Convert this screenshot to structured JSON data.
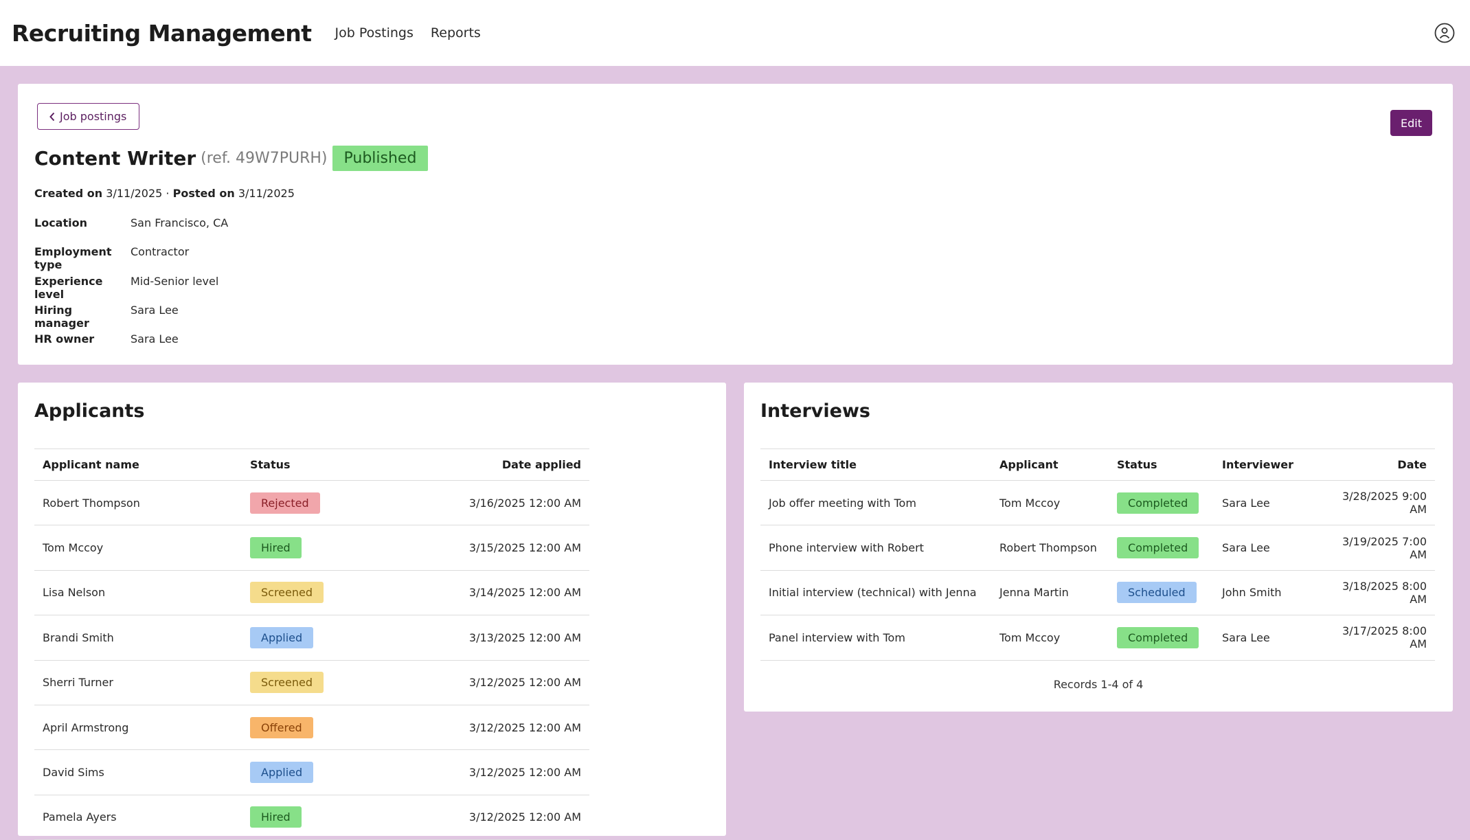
{
  "header": {
    "title": "Recruiting Management",
    "nav": [
      "Job Postings",
      "Reports"
    ]
  },
  "posting": {
    "back_label": "Job postings",
    "edit_label": "Edit",
    "title": "Content Writer",
    "ref": "(ref. 49W7PURH)",
    "status": "Published",
    "created_label": "Created on",
    "created_date": "3/11/2025",
    "separator": "·",
    "posted_label": "Posted on",
    "posted_date": "3/11/2025",
    "details": [
      {
        "label": "Location",
        "value": "San Francisco, CA"
      },
      {
        "label": "Employment type",
        "value": "Contractor"
      },
      {
        "label": "Experience level",
        "value": "Mid-Senior level"
      },
      {
        "label": "Hiring manager",
        "value": "Sara Lee"
      },
      {
        "label": "HR owner",
        "value": "Sara Lee"
      }
    ]
  },
  "status_colors": {
    "Rejected": {
      "bg": "#f1a6ab",
      "fg": "#8a1f27"
    },
    "Hired": {
      "bg": "#87e088",
      "fg": "#1c5a1f"
    },
    "Screened": {
      "bg": "#f5dc8c",
      "fg": "#7a5a0a"
    },
    "Applied": {
      "bg": "#a7caf5",
      "fg": "#1d4f8c"
    },
    "Offered": {
      "bg": "#f8b56a",
      "fg": "#8a4208"
    },
    "Completed": {
      "bg": "#87e088",
      "fg": "#1c5a1f"
    },
    "Scheduled": {
      "bg": "#a7caf5",
      "fg": "#1d4f8c"
    }
  },
  "applicants": {
    "title": "Applicants",
    "columns": [
      "Applicant name",
      "Status",
      "Date applied"
    ],
    "rows": [
      {
        "name": "Robert Thompson",
        "status": "Rejected",
        "date": "3/16/2025 12:00 AM"
      },
      {
        "name": "Tom Mccoy",
        "status": "Hired",
        "date": "3/15/2025 12:00 AM"
      },
      {
        "name": "Lisa Nelson",
        "status": "Screened",
        "date": "3/14/2025 12:00 AM"
      },
      {
        "name": "Brandi Smith",
        "status": "Applied",
        "date": "3/13/2025 12:00 AM"
      },
      {
        "name": "Sherri Turner",
        "status": "Screened",
        "date": "3/12/2025 12:00 AM"
      },
      {
        "name": "April Armstrong",
        "status": "Offered",
        "date": "3/12/2025 12:00 AM"
      },
      {
        "name": "David Sims",
        "status": "Applied",
        "date": "3/12/2025 12:00 AM"
      },
      {
        "name": "Pamela Ayers",
        "status": "Hired",
        "date": "3/12/2025 12:00 AM"
      }
    ]
  },
  "interviews": {
    "title": "Interviews",
    "columns": [
      "Interview title",
      "Applicant",
      "Status",
      "Interviewer",
      "Date"
    ],
    "rows": [
      {
        "title": "Job offer meeting with Tom",
        "applicant": "Tom Mccoy",
        "status": "Completed",
        "interviewer": "Sara Lee",
        "date": "3/28/2025 9:00 AM"
      },
      {
        "title": "Phone interview with Robert",
        "applicant": "Robert Thompson",
        "status": "Completed",
        "interviewer": "Sara Lee",
        "date": "3/19/2025 7:00 AM"
      },
      {
        "title": "Initial interview (technical) with Jenna",
        "applicant": "Jenna Martin",
        "status": "Scheduled",
        "interviewer": "John Smith",
        "date": "3/18/2025 8:00 AM"
      },
      {
        "title": "Panel interview with Tom",
        "applicant": "Tom Mccoy",
        "status": "Completed",
        "interviewer": "Sara Lee",
        "date": "3/17/2025 8:00 AM"
      }
    ],
    "records": "Records 1-4 of 4"
  }
}
